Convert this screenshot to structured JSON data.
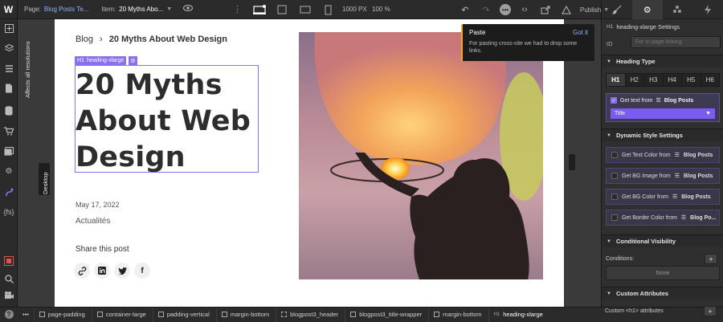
{
  "topbar": {
    "logo": "W",
    "page_label": "Page:",
    "page_value": "Blog Posts Te...",
    "item_label": "Item:",
    "item_value": "20 Myths Abo...",
    "canvas_width": "1000 PX",
    "zoom": "100 %",
    "publish_label": "Publish",
    "tabs": [
      "style-brush-icon",
      "settings-gear-icon",
      "interactions-drops-icon",
      "lightning-icon"
    ]
  },
  "canvas": {
    "resize_label": "Affects all resolutions",
    "breakpoint_label": "Desktop"
  },
  "page": {
    "breadcrumb_parent": "Blog",
    "breadcrumb_separator": "›",
    "breadcrumb_current": "20 Myths About Web Design",
    "selection_badge": "heading-xlarge",
    "selection_badge_tag": "H1",
    "heading": "20 Myths About Web Design",
    "date": "May 17, 2022",
    "category": "Actualités",
    "share_title": "Share this post",
    "share_icons": [
      "link-icon",
      "linkedin-icon",
      "twitter-icon",
      "facebook-icon"
    ]
  },
  "paste_tooltip": {
    "title": "Paste",
    "action": "Got it",
    "message": "For pasting cross-site we had to drop some links."
  },
  "panel": {
    "header_tag": "H1",
    "header_title": "heading-xlarge Settings",
    "id_label": "ID",
    "id_placeholder": "For in-page linking",
    "heading_type_title": "Heading Type",
    "heading_tabs": [
      "H1",
      "H2",
      "H3",
      "H4",
      "H5",
      "H6"
    ],
    "get_text_label": "Get text from",
    "get_text_source": "Blog Posts",
    "get_text_field": "Title",
    "dynamic_title": "Dynamic Style Settings",
    "dynamic_rows": [
      {
        "label": "Get Text Color from",
        "source": "Blog Posts"
      },
      {
        "label": "Get BG Image from",
        "source": "Blog Posts"
      },
      {
        "label": "Get BG Color from",
        "source": "Blog Posts"
      },
      {
        "label": "Get Border Color from",
        "source": "Blog Po..."
      }
    ],
    "conditional_title": "Conditional Visibility",
    "conditions_label": "Conditions:",
    "conditions_value": "None",
    "custom_attr_title": "Custom Attributes",
    "custom_attr_label": "Custom <h1> attributes"
  },
  "bottombar": {
    "dots": "•••",
    "items": [
      {
        "label": "page-padding",
        "type": "box"
      },
      {
        "label": "container-large",
        "type": "box"
      },
      {
        "label": "padding-vertical",
        "type": "box"
      },
      {
        "label": "margin-bottom",
        "type": "box"
      },
      {
        "label": "blogpost3_header",
        "type": "grid"
      },
      {
        "label": "blogpost3_title-wrapper",
        "type": "box"
      },
      {
        "label": "margin-bottom",
        "type": "box"
      },
      {
        "label": "heading-xlarge",
        "type": "h1"
      }
    ]
  },
  "colors": {
    "accent_purple": "#8b6ff0",
    "tooltip_accent": "#f5a623",
    "link_blue": "#8ab4ff"
  }
}
